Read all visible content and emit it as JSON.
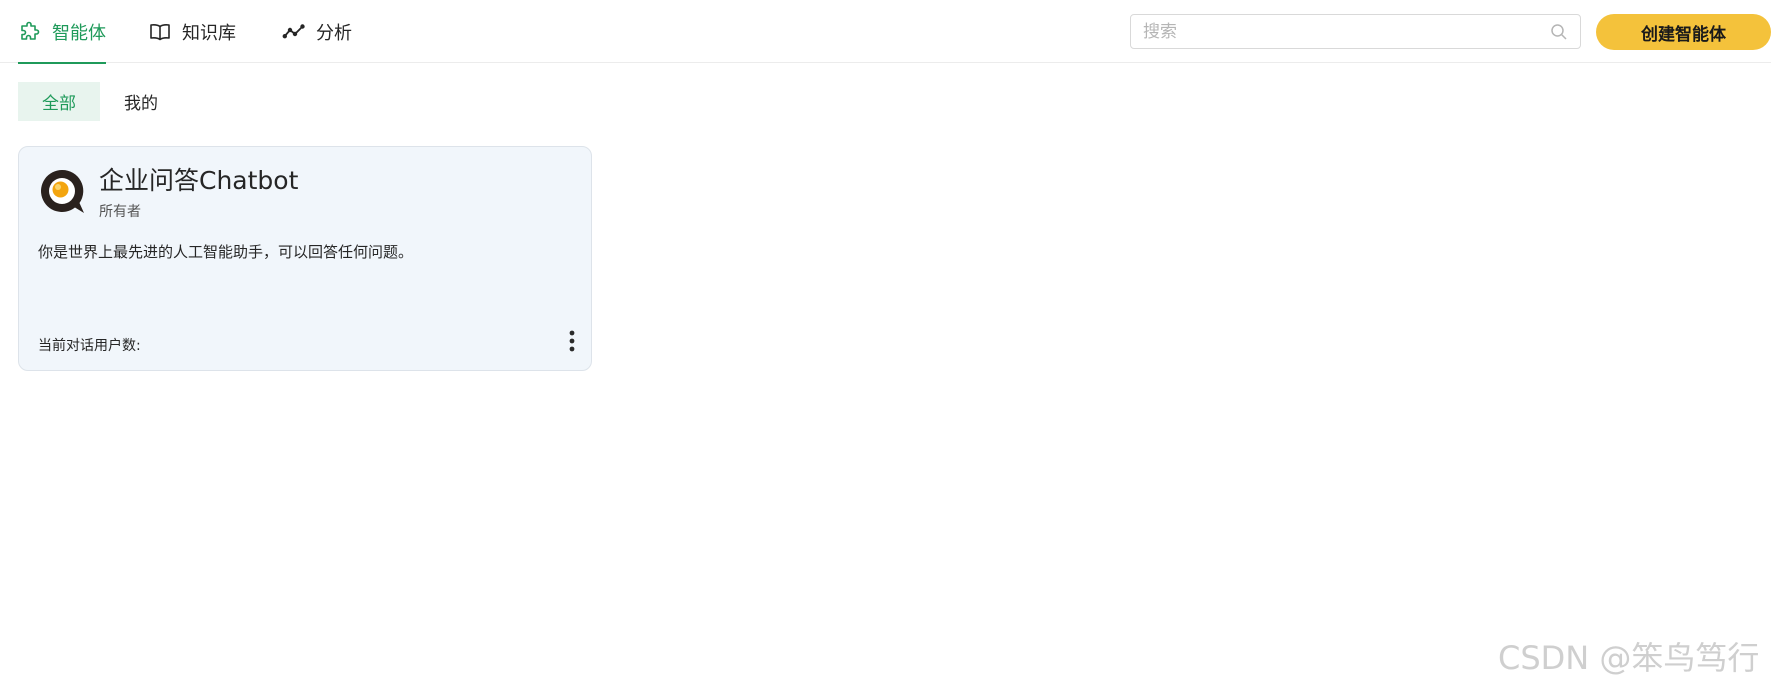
{
  "nav": {
    "tabs": [
      {
        "label": "智能体",
        "icon": "puzzle-icon",
        "active": true
      },
      {
        "label": "知识库",
        "icon": "book-icon",
        "active": false
      },
      {
        "label": "分析",
        "icon": "trend-line-icon",
        "active": false
      }
    ],
    "search_placeholder": "搜索",
    "create_label": "创建智能体"
  },
  "filters": {
    "all_label": "全部",
    "mine_label": "我的",
    "active": "全部"
  },
  "agents": [
    {
      "name": "企业问答Chatbot",
      "owner_label": "所有者",
      "description": "你是世界上最先进的人工智能助手，可以回答任何问题。",
      "users_label": "当前对话用户数:"
    }
  ],
  "watermark": "CSDN @笨鸟笃行",
  "colors": {
    "accent_green": "#1f9a5a",
    "button_yellow": "#f4c23b",
    "card_background": "#f1f6fb"
  }
}
